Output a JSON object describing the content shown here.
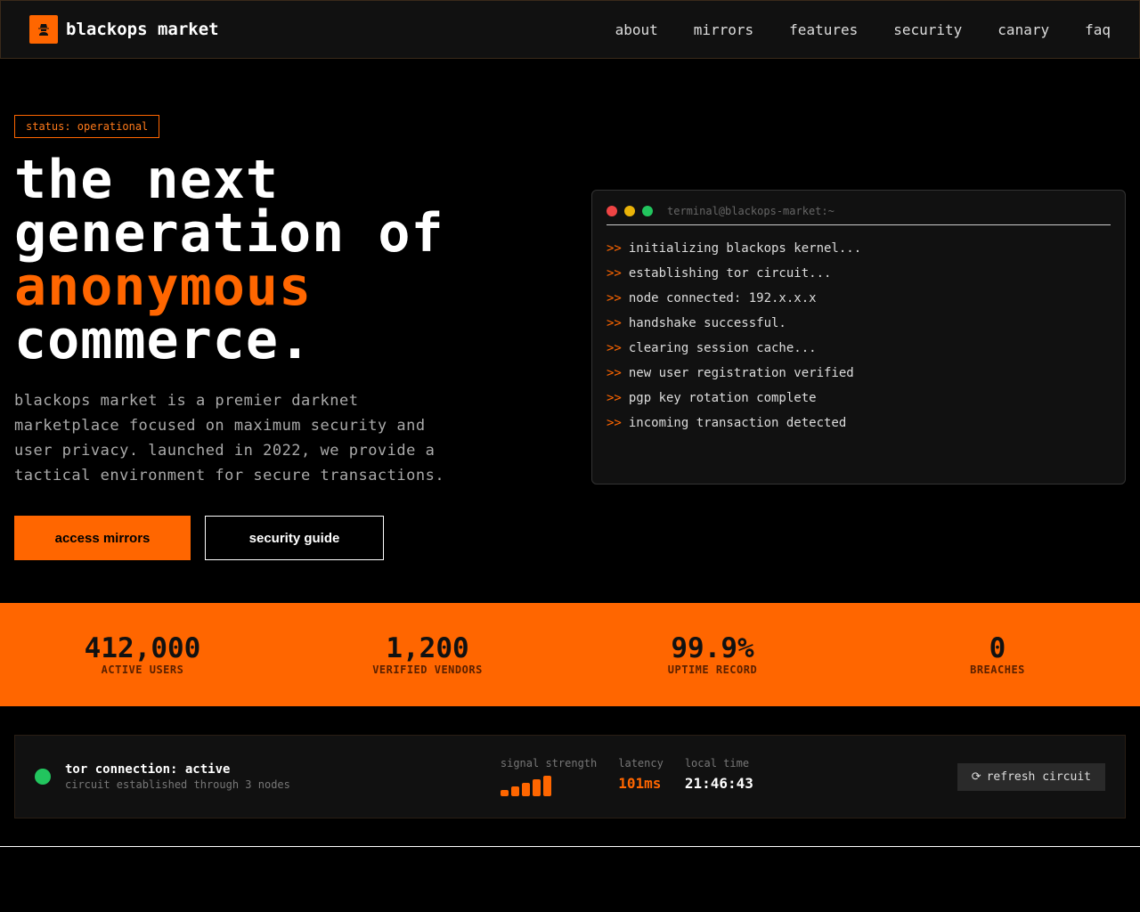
{
  "nav": {
    "brand": "blackops market",
    "links": [
      "about",
      "mirrors",
      "features",
      "security",
      "canary",
      "faq"
    ]
  },
  "hero": {
    "status": "status: operational",
    "title_l1": "the next",
    "title_l2": "generation of",
    "title_accent": "anonymous",
    "title_l4": "commerce.",
    "description": "blackops market is a premier darknet marketplace focused on maximum security and user privacy. launched in 2022, we provide a tactical environment for secure transactions.",
    "primary_button": "access mirrors",
    "secondary_button": "security guide"
  },
  "terminal": {
    "title": "terminal@blackops-market:~",
    "prompt": ">>",
    "lines": [
      "initializing blackops kernel...",
      "establishing tor circuit...",
      "node connected: 192.x.x.x",
      "handshake successful.",
      "clearing session cache...",
      "new user registration verified",
      "pgp key rotation complete",
      "incoming transaction detected"
    ]
  },
  "stats": [
    {
      "value": "412,000",
      "label": "ACTIVE USERS"
    },
    {
      "value": "1,200",
      "label": "VERIFIED VENDORS"
    },
    {
      "value": "99.9%",
      "label": "UPTIME RECORD"
    },
    {
      "value": "0",
      "label": "BREACHES"
    }
  ],
  "tor": {
    "title": "tor connection: active",
    "subtitle": "circuit established through 3 nodes",
    "signal_label": "signal strength",
    "signal_bars": 5,
    "latency_label": "latency",
    "latency": "101ms",
    "time_label": "local time",
    "time": "21:46:43",
    "refresh": "refresh circuit"
  },
  "colors": {
    "accent": "#ff6600",
    "ok": "#22c55e"
  }
}
